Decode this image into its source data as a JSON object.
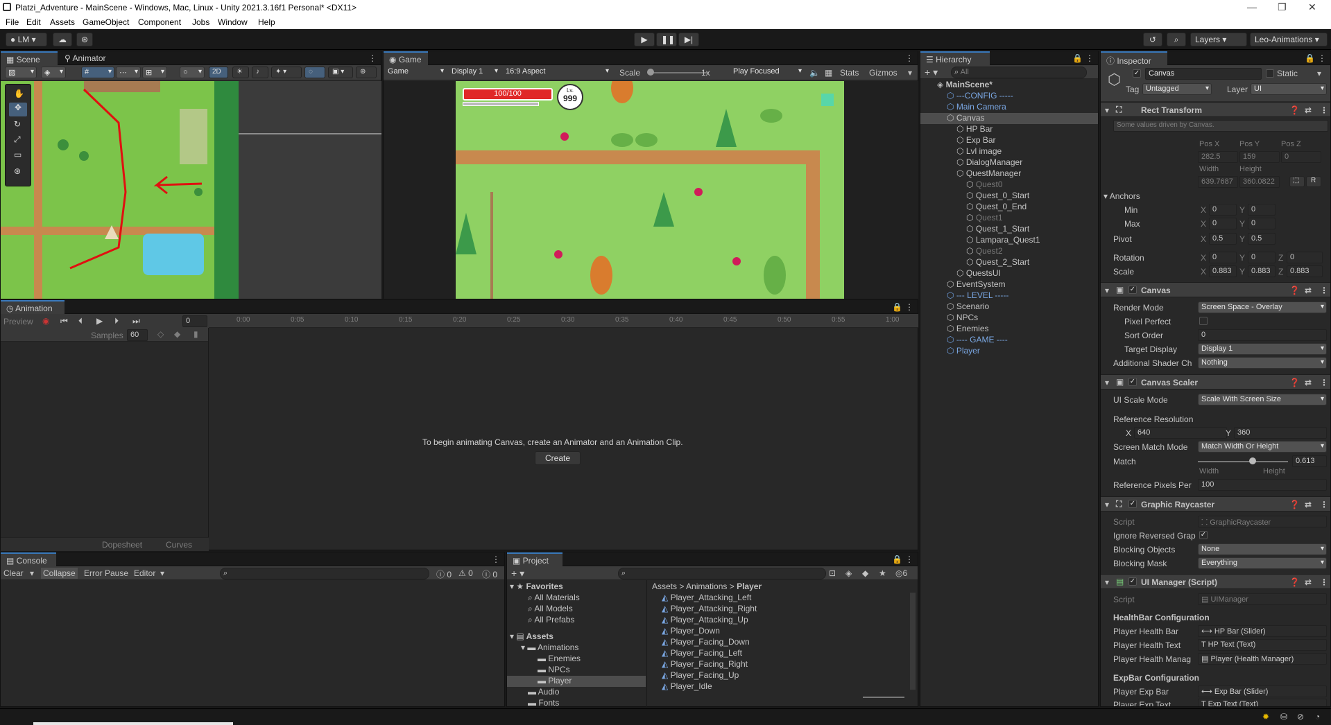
{
  "window": {
    "title": "Platzi_Adventure - MainScene - Windows, Mac, Linux - Unity 2021.3.16f1 Personal* <DX11>"
  },
  "menu": [
    "File",
    "Edit",
    "Assets",
    "GameObject",
    "Component",
    "Jobs",
    "Window",
    "Help"
  ],
  "toolbar": {
    "account": "LM",
    "layers": "Layers",
    "layout": "Leo-Animations"
  },
  "scene_panel": {
    "tab_scene": "Scene",
    "tab_animator": "Animator",
    "mode_2d": "2D"
  },
  "game_panel": {
    "tab": "Game",
    "view": "Game",
    "display": "Display 1",
    "aspect": "16:9 Aspect",
    "scale_label": "Scale",
    "scale_value": "1x",
    "play_mode": "Play Focused",
    "stats": "Stats",
    "gizmos": "Gizmos",
    "hp_text": "100/100",
    "level_label": "Lv.",
    "level_value": "999"
  },
  "animation_panel": {
    "tab": "Animation",
    "preview": "Preview",
    "frame": "0",
    "samples_label": "Samples",
    "samples_value": "60",
    "ticks": [
      "0:00",
      "0:05",
      "0:10",
      "0:15",
      "0:20",
      "0:25",
      "0:30",
      "0:35",
      "0:40",
      "0:45",
      "0:50",
      "0:55",
      "1:00"
    ],
    "message": "To begin animating Canvas, create an Animator and an Animation Clip.",
    "create": "Create",
    "dopesheet": "Dopesheet",
    "curves": "Curves"
  },
  "console": {
    "tab": "Console",
    "clear": "Clear",
    "collapse": "Collapse",
    "error_pause": "Error Pause",
    "editor": "Editor",
    "counts": [
      "0",
      "0",
      "0"
    ]
  },
  "project": {
    "tab": "Project",
    "hidden_count": "6",
    "favorites_label": "Favorites",
    "favorites": [
      "All Materials",
      "All Models",
      "All Prefabs"
    ],
    "assets_label": "Assets",
    "folders": [
      {
        "name": "Animations",
        "indent": 1
      },
      {
        "name": "Enemies",
        "indent": 2
      },
      {
        "name": "NPCs",
        "indent": 2
      },
      {
        "name": "Player",
        "indent": 2
      },
      {
        "name": "Audio",
        "indent": 1
      },
      {
        "name": "Fonts",
        "indent": 1
      }
    ],
    "breadcrumb": [
      "Assets",
      "Animations",
      "Player"
    ],
    "files": [
      "Player_Attacking_Left",
      "Player_Attacking_Right",
      "Player_Attacking_Up",
      "Player_Down",
      "Player_Facing_Down",
      "Player_Facing_Left",
      "Player_Facing_Right",
      "Player_Facing_Up",
      "Player_Idle"
    ]
  },
  "hierarchy": {
    "tab": "Hierarchy",
    "search_placeholder": "All",
    "items": [
      {
        "name": "MainScene*",
        "indent": 0,
        "kind": "scene"
      },
      {
        "name": "---CONFIG -----",
        "indent": 1,
        "kind": "blue"
      },
      {
        "name": "Main Camera",
        "indent": 1,
        "kind": "blue"
      },
      {
        "name": "Canvas",
        "indent": 1,
        "kind": "selected"
      },
      {
        "name": "HP Bar",
        "indent": 2,
        "kind": "normal"
      },
      {
        "name": "Exp Bar",
        "indent": 2,
        "kind": "normal"
      },
      {
        "name": "Lvl image",
        "indent": 2,
        "kind": "normal"
      },
      {
        "name": "DialogManager",
        "indent": 2,
        "kind": "normal"
      },
      {
        "name": "QuestManager",
        "indent": 2,
        "kind": "normal"
      },
      {
        "name": "Quest0",
        "indent": 3,
        "kind": "dim"
      },
      {
        "name": "Quest_0_Start",
        "indent": 3,
        "kind": "normal"
      },
      {
        "name": "Quest_0_End",
        "indent": 3,
        "kind": "normal"
      },
      {
        "name": "Quest1",
        "indent": 3,
        "kind": "dim"
      },
      {
        "name": "Quest_1_Start",
        "indent": 3,
        "kind": "normal"
      },
      {
        "name": "Lampara_Quest1",
        "indent": 3,
        "kind": "normal"
      },
      {
        "name": "Quest2",
        "indent": 3,
        "kind": "dim"
      },
      {
        "name": "Quest_2_Start",
        "indent": 3,
        "kind": "normal"
      },
      {
        "name": "QuestsUI",
        "indent": 2,
        "kind": "normal"
      },
      {
        "name": "EventSystem",
        "indent": 1,
        "kind": "normal"
      },
      {
        "name": "--- LEVEL -----",
        "indent": 1,
        "kind": "blue"
      },
      {
        "name": "Scenario",
        "indent": 1,
        "kind": "normal"
      },
      {
        "name": "NPCs",
        "indent": 1,
        "kind": "normal"
      },
      {
        "name": "Enemies",
        "indent": 1,
        "kind": "normal"
      },
      {
        "name": "---- GAME ----",
        "indent": 1,
        "kind": "blue"
      },
      {
        "name": "Player",
        "indent": 1,
        "kind": "blue"
      }
    ]
  },
  "inspector": {
    "tab": "Inspector",
    "object_name": "Canvas",
    "static": "Static",
    "tag_label": "Tag",
    "tag": "Untagged",
    "layer_label": "Layer",
    "layer": "UI",
    "rect": {
      "title": "Rect Transform",
      "note": "Some values driven by Canvas.",
      "posx_l": "Pos X",
      "posy_l": "Pos Y",
      "posz_l": "Pos Z",
      "posx": "282.5",
      "posy": "159",
      "posz": "0",
      "width_l": "Width",
      "height_l": "Height",
      "width": "639.7687",
      "height": "360.0822",
      "anchors": "Anchors",
      "min": "Min",
      "max": "Max",
      "pivot": "Pivot",
      "rotation": "Rotation",
      "scale": "Scale",
      "x": "X",
      "y": "Y",
      "z": "Z",
      "min_x": "0",
      "min_y": "0",
      "max_x": "0",
      "max_y": "0",
      "pivot_x": "0.5",
      "pivot_y": "0.5",
      "rot_x": "0",
      "rot_y": "0",
      "rot_z": "0",
      "scale_x": "0.883",
      "scale_y": "0.883",
      "scale_z": "0.883",
      "r_btn": "R"
    },
    "canvas": {
      "title": "Canvas",
      "render_mode_l": "Render Mode",
      "render_mode": "Screen Space - Overlay",
      "pixel_perfect_l": "Pixel Perfect",
      "sort_order_l": "Sort Order",
      "sort_order": "0",
      "target_display_l": "Target Display",
      "target_display": "Display 1",
      "shader_l": "Additional Shader Ch",
      "shader": "Nothing"
    },
    "scaler": {
      "title": "Canvas Scaler",
      "ui_scale_l": "UI Scale Mode",
      "ui_scale": "Scale With Screen Size",
      "ref_res_l": "Reference Resolution",
      "ref_x": "640",
      "ref_y": "360",
      "match_mode_l": "Screen Match Mode",
      "match_mode": "Match Width Or Height",
      "match_l": "Match",
      "match": "0.613",
      "width_l": "Width",
      "height_l": "Height",
      "ppu_l": "Reference Pixels Per",
      "ppu": "100"
    },
    "raycaster": {
      "title": "Graphic Raycaster",
      "script_l": "Script",
      "script": "GraphicRaycaster",
      "ignore_l": "Ignore Reversed Grap",
      "blocking_l": "Blocking Objects",
      "blocking": "None",
      "mask_l": "Blocking Mask",
      "mask": "Everything"
    },
    "uimanager": {
      "title": "UI Manager (Script)",
      "script_l": "Script",
      "script": "UIManager",
      "hb_section": "HealthBar Configuration",
      "phb_l": "Player Health Bar",
      "phb": "HP Bar (Slider)",
      "pht_l": "Player Health Text",
      "pht": "HP Text (Text)",
      "phm_l": "Player Health Manag",
      "phm": "Player (Health Manager)",
      "exp_section": "ExpBar Configuration",
      "peb_l": "Player Exp Bar",
      "peb": "Exp Bar (Slider)",
      "pet_l": "Player Exp Text",
      "pet": "Exp Text (Text)"
    }
  },
  "colors": {
    "accent": "#3a79bb",
    "hp_red": "#e02828",
    "grass": "#7cc44a",
    "path": "#c8894e",
    "selection": "#2c5d87"
  }
}
